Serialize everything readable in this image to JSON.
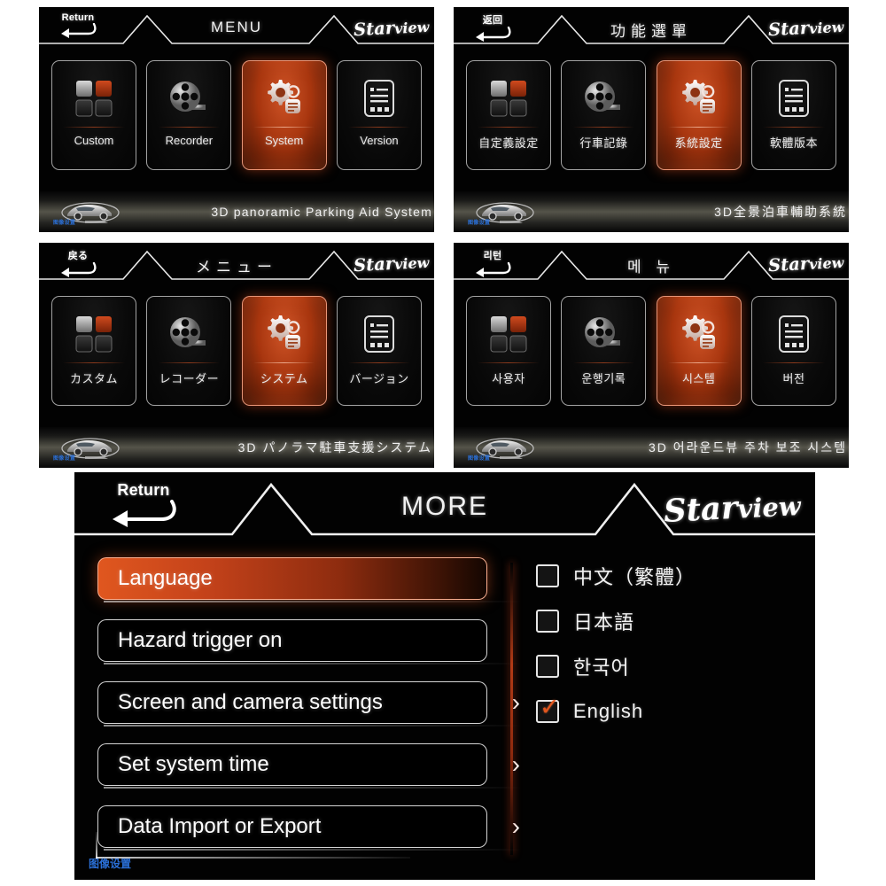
{
  "brand": {
    "word1": "Star",
    "word2": "view"
  },
  "panels": [
    {
      "id": "menu-en",
      "return_label": "Return",
      "title": "MENU",
      "tiles": [
        {
          "label": "Custom",
          "icon": "grid-squares-icon",
          "active": false
        },
        {
          "label": "Recorder",
          "icon": "film-reel-icon",
          "active": false
        },
        {
          "label": "System",
          "icon": "gear-settings-icon",
          "active": true
        },
        {
          "label": "Version",
          "icon": "document-list-icon",
          "active": false
        }
      ],
      "footer_title": "3D panoramic Parking Aid System",
      "logo_text": "图像设置"
    },
    {
      "id": "menu-zh",
      "return_label": "返回",
      "title": "功能選單",
      "tiles": [
        {
          "label": "自定義設定",
          "icon": "grid-squares-icon",
          "active": false
        },
        {
          "label": "行車記錄",
          "icon": "film-reel-icon",
          "active": false
        },
        {
          "label": "系統設定",
          "icon": "gear-settings-icon",
          "active": true
        },
        {
          "label": "軟體版本",
          "icon": "document-list-icon",
          "active": false
        }
      ],
      "footer_title": "3D全景泊車輔助系統",
      "logo_text": "图像设置"
    },
    {
      "id": "menu-ja",
      "return_label": "戻る",
      "title": "メニュー",
      "tiles": [
        {
          "label": "カスタム",
          "icon": "grid-squares-icon",
          "active": false
        },
        {
          "label": "レコーダー",
          "icon": "film-reel-icon",
          "active": false
        },
        {
          "label": "システム",
          "icon": "gear-settings-icon",
          "active": true
        },
        {
          "label": "バージョン",
          "icon": "document-list-icon",
          "active": false
        }
      ],
      "footer_title": "3D パノラマ駐車支援システム",
      "logo_text": "图像设置"
    },
    {
      "id": "menu-ko",
      "return_label": "리턴",
      "title": "메 뉴",
      "tiles": [
        {
          "label": "사용자",
          "icon": "grid-squares-icon",
          "active": false
        },
        {
          "label": "운행기록",
          "icon": "film-reel-icon",
          "active": false
        },
        {
          "label": "시스템",
          "icon": "gear-settings-icon",
          "active": true
        },
        {
          "label": "버전",
          "icon": "document-list-icon",
          "active": false
        }
      ],
      "footer_title": "3D 어라운드뷰 주차 보조 시스템",
      "logo_text": "图像设置"
    }
  ],
  "more_panel": {
    "return_label": "Return",
    "title": "MORE",
    "logo_text": "图像设置",
    "rows": [
      {
        "label": "Language",
        "selected": true,
        "chevron": false
      },
      {
        "label": "Hazard trigger on",
        "selected": false,
        "chevron": false
      },
      {
        "label": "Screen and camera settings",
        "selected": false,
        "chevron": true
      },
      {
        "label": "Set system time",
        "selected": false,
        "chevron": true
      },
      {
        "label": "Data Import or Export",
        "selected": false,
        "chevron": true
      }
    ],
    "language_options": [
      {
        "label": "中文（繁體）",
        "checked": false
      },
      {
        "label": "日本語",
        "checked": false
      },
      {
        "label": "한국어",
        "checked": false
      },
      {
        "label": "English",
        "checked": true
      }
    ],
    "chevron_glyph": "›",
    "check_glyph": "✓"
  },
  "colors": {
    "accent": "#d2501e",
    "selected_start": "#e0571f",
    "panel_bg": "#020202",
    "logo_blue": "#2a6fd6",
    "text": "#f2f2f2"
  }
}
